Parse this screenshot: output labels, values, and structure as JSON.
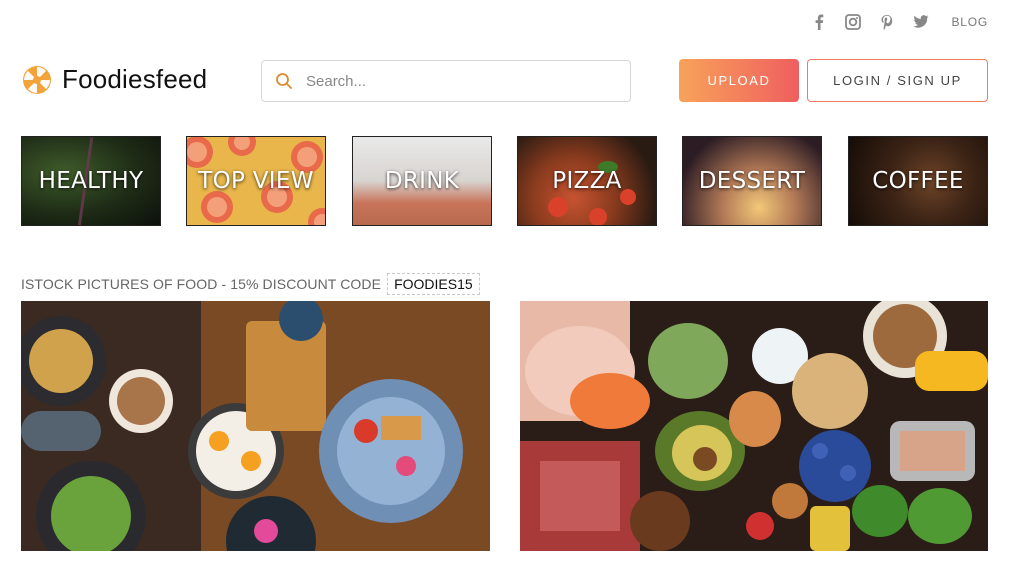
{
  "social": {
    "icons": [
      "facebook-icon",
      "instagram-icon",
      "pinterest-icon",
      "twitter-icon"
    ],
    "blog_label": "BLOG"
  },
  "header": {
    "logo_text": "Foodiesfeed",
    "search_placeholder": "Search...",
    "upload_label": "UPLOAD",
    "login_label": "LOGIN / SIGN UP"
  },
  "categories": [
    {
      "label": "HEALTHY"
    },
    {
      "label": "TOP VIEW"
    },
    {
      "label": "DRINK"
    },
    {
      "label": "PIZZA"
    },
    {
      "label": "DESSERT"
    },
    {
      "label": "COFFEE"
    }
  ],
  "promo": {
    "text": "ISTOCK PICTURES OF FOOD - 15% DISCOUNT CODE",
    "code": "FOODIES15"
  },
  "colors": {
    "accent_start": "#f8a25a",
    "accent_end": "#ef5f5f",
    "search_icon": "#e08a2c"
  }
}
